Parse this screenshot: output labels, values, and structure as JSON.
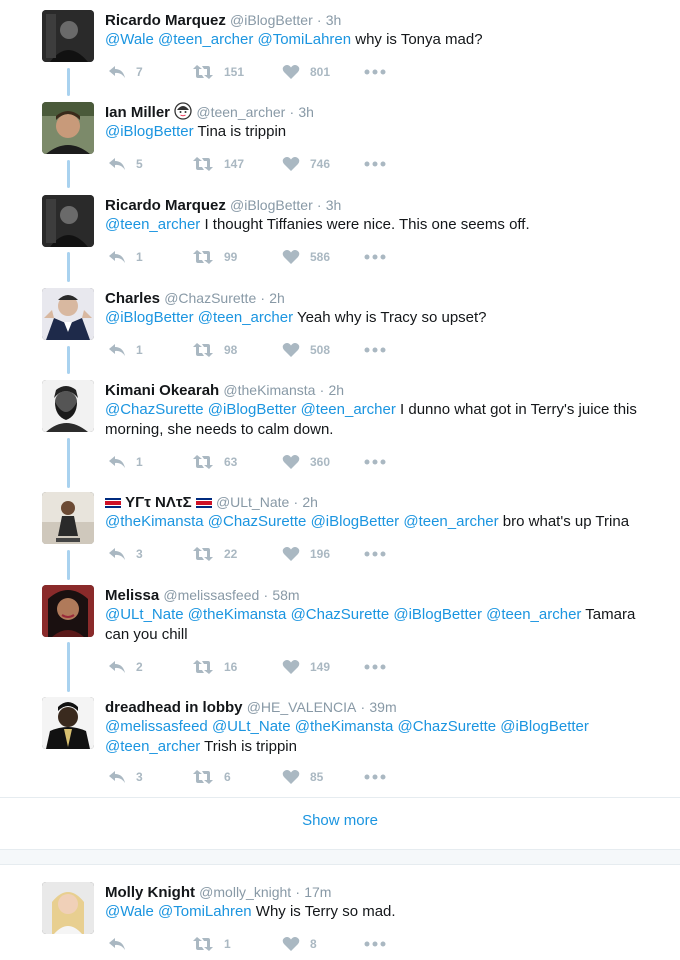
{
  "colors": {
    "mention": "#1b95e0",
    "muted": "#8899a6",
    "thread_line": "#a9d2ef",
    "action": "#aab8c2"
  },
  "tweets": [
    {
      "name": "Ricardo Marquez",
      "handle": "@iBlogBetter",
      "time": "3h",
      "body": [
        {
          "m": "@Wale"
        },
        {
          "t": " "
        },
        {
          "m": "@teen_archer"
        },
        {
          "t": " "
        },
        {
          "m": "@TomiLahren"
        },
        {
          "t": " why is Tonya mad?"
        }
      ],
      "replies": "7",
      "retweets": "151",
      "likes": "801"
    },
    {
      "name": "Ian Miller",
      "handle": "@teen_archer",
      "time": "3h",
      "emoji": "face-emoji",
      "body": [
        {
          "m": "@iBlogBetter"
        },
        {
          "t": " Tina is trippin"
        }
      ],
      "replies": "5",
      "retweets": "147",
      "likes": "746"
    },
    {
      "name": "Ricardo Marquez",
      "handle": "@iBlogBetter",
      "time": "3h",
      "body": [
        {
          "m": "@teen_archer"
        },
        {
          "t": " I thought Tiffanies were nice. This one seems off."
        }
      ],
      "replies": "1",
      "retweets": "99",
      "likes": "586"
    },
    {
      "name": "Charles",
      "handle": "@ChazSurette",
      "time": "2h",
      "body": [
        {
          "m": "@iBlogBetter"
        },
        {
          "t": " "
        },
        {
          "m": "@teen_archer"
        },
        {
          "t": " Yeah why is Tracy so upset?"
        }
      ],
      "replies": "1",
      "retweets": "98",
      "likes": "508"
    },
    {
      "name": "Kimani Okearah",
      "handle": "@theKimansta",
      "time": "2h",
      "body": [
        {
          "m": "@ChazSurette"
        },
        {
          "t": " "
        },
        {
          "m": "@iBlogBetter"
        },
        {
          "t": " "
        },
        {
          "m": "@teen_archer"
        },
        {
          "t": " I dunno what got in Terry's juice this morning, she needs to calm down."
        }
      ],
      "replies": "1",
      "retweets": "63",
      "likes": "360"
    },
    {
      "name": "ΥΓτ ΝΛτΣ",
      "handle": "@ULt_Nate",
      "time": "2h",
      "flags": true,
      "body": [
        {
          "m": "@theKimansta"
        },
        {
          "t": " "
        },
        {
          "m": "@ChazSurette"
        },
        {
          "t": " "
        },
        {
          "m": "@iBlogBetter"
        },
        {
          "t": " "
        },
        {
          "m": "@teen_archer"
        },
        {
          "t": " bro what's up Trina"
        }
      ],
      "replies": "3",
      "retweets": "22",
      "likes": "196"
    },
    {
      "name": "Melissa",
      "handle": "@melissasfeed",
      "time": "58m",
      "body": [
        {
          "m": "@ULt_Nate"
        },
        {
          "t": " "
        },
        {
          "m": "@theKimansta"
        },
        {
          "t": " "
        },
        {
          "m": "@ChazSurette"
        },
        {
          "t": " "
        },
        {
          "m": "@iBlogBetter"
        },
        {
          "t": " "
        },
        {
          "m": "@teen_archer"
        },
        {
          "t": " Tamara can you chill"
        }
      ],
      "replies": "2",
      "retweets": "16",
      "likes": "149"
    },
    {
      "name": "dreadhead in lobby",
      "handle": "@HE_VALENCIA",
      "time": "39m",
      "body": [
        {
          "m": "@melissasfeed"
        },
        {
          "t": " "
        },
        {
          "m": "@ULt_Nate"
        },
        {
          "t": " "
        },
        {
          "m": "@theKimansta"
        },
        {
          "t": " "
        },
        {
          "m": "@ChazSurette"
        },
        {
          "t": " "
        },
        {
          "m": "@iBlogBetter"
        },
        {
          "t": " "
        },
        {
          "m": "@teen_archer"
        },
        {
          "t": " Trish is trippin"
        }
      ],
      "replies": "3",
      "retweets": "6",
      "likes": "85"
    }
  ],
  "show_more": "Show more",
  "bottom_tweet": {
    "name": "Molly Knight",
    "handle": "@molly_knight",
    "time": "17m",
    "body": [
      {
        "m": "@Wale"
      },
      {
        "t": " "
      },
      {
        "m": "@TomiLahren"
      },
      {
        "t": " Why is Terry so mad."
      }
    ],
    "replies": "",
    "retweets": "1",
    "likes": "8"
  }
}
